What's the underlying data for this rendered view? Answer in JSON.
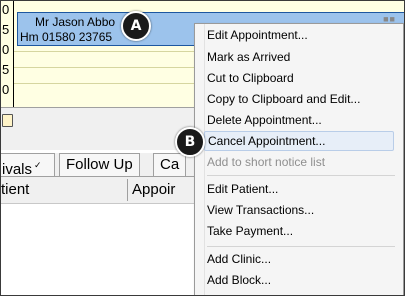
{
  "book": {
    "time_digits": [
      "0",
      "5",
      "0",
      "5",
      "0"
    ],
    "appointment": {
      "patient": "Mr Jason Abbo",
      "phone": "Hm 01580 23765"
    }
  },
  "tabs": [
    {
      "label": "ivals",
      "checked": true
    },
    {
      "label": "Follow Up",
      "checked": false
    },
    {
      "label": "Ca",
      "checked": false
    }
  ],
  "grid": {
    "columns": [
      "tient",
      "Appoir"
    ]
  },
  "context_menu": {
    "groups": [
      [
        {
          "label": "Edit Appointment...",
          "enabled": true
        },
        {
          "label": "Mark as Arrived",
          "enabled": true
        },
        {
          "label": "Cut to Clipboard",
          "enabled": true
        },
        {
          "label": "Copy to Clipboard and Edit...",
          "enabled": true
        },
        {
          "label": "Delete Appointment...",
          "enabled": true
        },
        {
          "label": "Cancel Appointment...",
          "enabled": true,
          "highlighted": true
        },
        {
          "label": "Add to short notice list",
          "enabled": false
        }
      ],
      [
        {
          "label": "Edit Patient...",
          "enabled": true
        },
        {
          "label": "View Transactions...",
          "enabled": true
        },
        {
          "label": "Take Payment...",
          "enabled": true
        }
      ],
      [
        {
          "label": "Add Clinic...",
          "enabled": true
        },
        {
          "label": "Add Block...",
          "enabled": true
        }
      ]
    ]
  },
  "markers": {
    "a": "A",
    "b": "B"
  },
  "colors": {
    "appointment_fill": "#9cc3ec",
    "appointment_border": "#1d57a0",
    "book_background": "#ffffe3",
    "menu_highlight": "#e7eef8",
    "disabled_text": "#8f8f8f"
  }
}
